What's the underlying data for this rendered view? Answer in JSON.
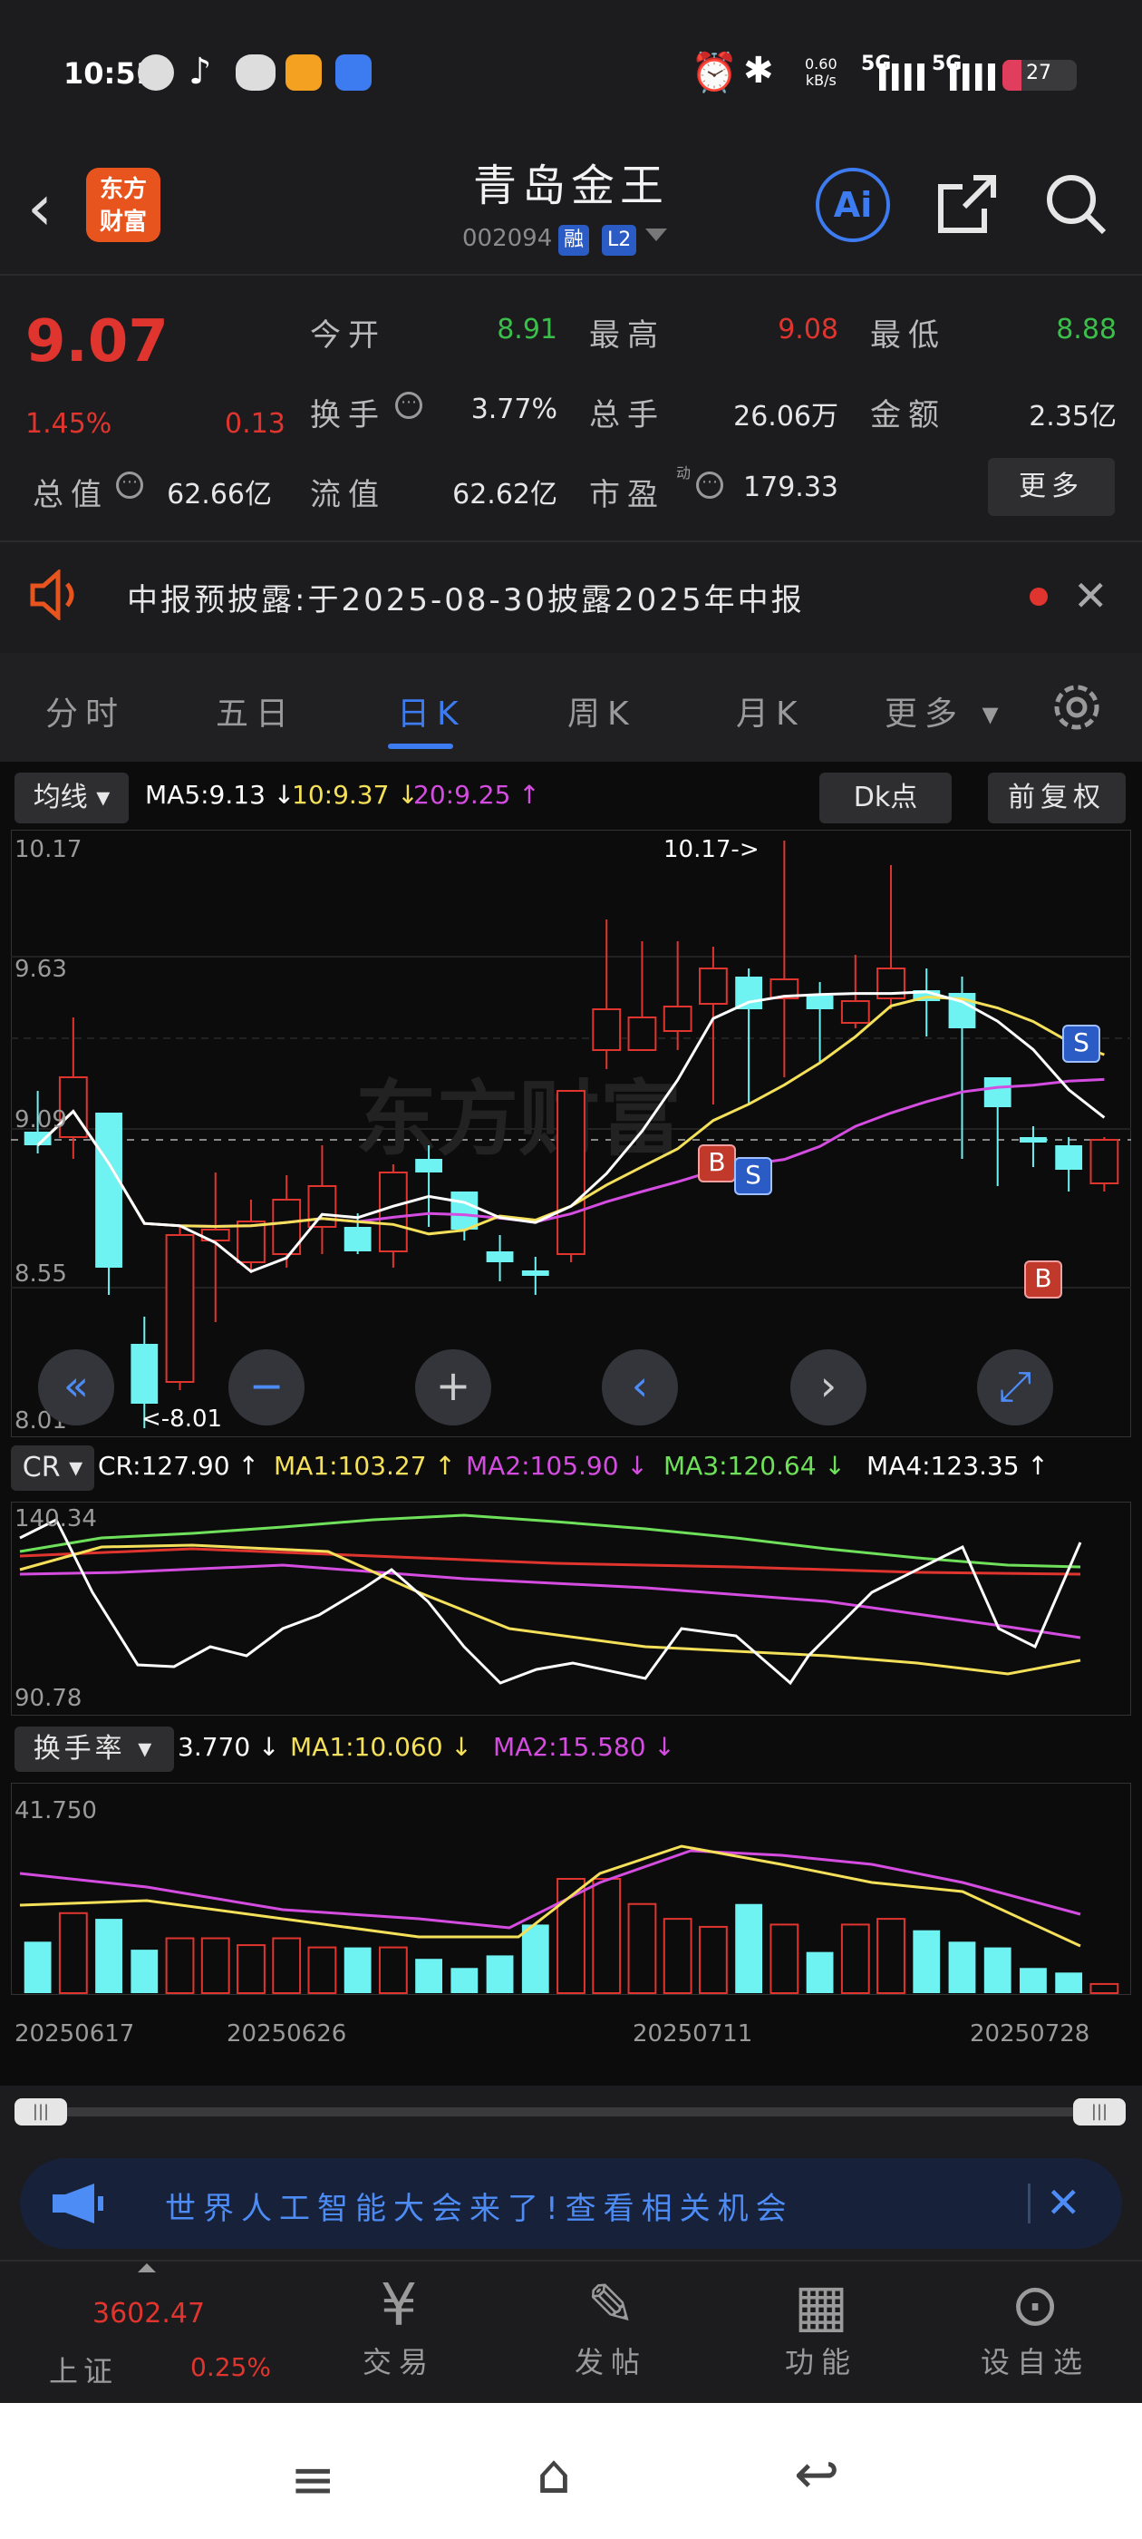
{
  "status": {
    "time": "10:51",
    "net_speed_top": "0.60",
    "net_speed_unit": "kB/s",
    "sig1": "5G",
    "sig2": "5G",
    "battery": "27"
  },
  "header": {
    "logo": "东方\n财富",
    "title": "青岛金王",
    "code": "002094",
    "badge1": "融",
    "badge2": "L2",
    "ai": "Ai"
  },
  "quote": {
    "price": "9.07",
    "change_pct": "1.45%",
    "change": "0.13",
    "open_label": "今开",
    "open": "8.91",
    "high_label": "最高",
    "high": "9.08",
    "low_label": "最低",
    "low": "8.88",
    "turnover_label": "换手",
    "turnover": "3.77%",
    "volume_label": "总手",
    "volume": "26.06万",
    "amount_label": "金额",
    "amount": "2.35亿",
    "mktcap_label": "总值",
    "mktcap": "62.66亿",
    "float_label": "流值",
    "float": "62.62亿",
    "pe_label": "市盈",
    "pe_sup": "动",
    "pe": "179.33",
    "more": "更多"
  },
  "notice": {
    "text": "中报预披露:于2025-08-30披露2025年中报"
  },
  "tabs": [
    "分时",
    "五日",
    "日K",
    "周K",
    "月K",
    "更多"
  ],
  "kline": {
    "ma_select": "均线",
    "ma5": "MA5:9.13 ↓",
    "ma10": "10:9.37 ↓",
    "ma20": "20:9.25 ↑",
    "dk": "Dk点",
    "adjust": "前复权",
    "y_labels": [
      "10.17",
      "9.63",
      "9.09",
      "8.55",
      "8.01"
    ],
    "high_note": "10.17->",
    "low_note": "<-8.01"
  },
  "cr": {
    "select": "CR",
    "cr": "CR:127.90 ↑",
    "ma1": "MA1:103.27 ↑",
    "ma2": "MA2:105.90 ↓",
    "ma3": "MA3:120.64 ↓",
    "ma4": "MA4:123.35 ↑",
    "ytop": "140.34",
    "ybot": "90.78"
  },
  "turn": {
    "select": "换手率",
    "val": "3.770 ↓",
    "ma1": "MA1:10.060 ↓",
    "ma2": "MA2:15.580 ↓",
    "ytop": "41.750"
  },
  "dates": [
    "20250617",
    "20250626",
    "20250711",
    "20250728"
  ],
  "banner": {
    "text": "世界人工智能大会来了!查看相关机会"
  },
  "bottomnav": {
    "index_value": "3602.47",
    "index_name": "上证",
    "index_pct": "0.25%",
    "trade": "交易",
    "post": "发帖",
    "func": "功能",
    "watch": "设自选"
  },
  "colors": {
    "up": "#e0352f",
    "down": "#6ef2f2",
    "ma5": "#ffffff",
    "ma10": "#f5e05a",
    "ma20": "#d44de0",
    "accent": "#3d7bf0"
  },
  "chart_data": {
    "type": "candlestick",
    "series": [
      {
        "o": 9.1,
        "c": 9.05,
        "h": 9.25,
        "l": 9.02
      },
      {
        "o": 9.08,
        "c": 9.3,
        "h": 9.52,
        "l": 9.0
      },
      {
        "o": 9.17,
        "c": 8.6,
        "h": 9.17,
        "l": 8.5
      },
      {
        "o": 8.32,
        "c": 8.1,
        "h": 8.42,
        "l": 8.01
      },
      {
        "o": 8.18,
        "c": 8.72,
        "h": 8.75,
        "l": 8.15
      },
      {
        "o": 8.7,
        "c": 8.74,
        "h": 8.95,
        "l": 8.4
      },
      {
        "o": 8.62,
        "c": 8.77,
        "h": 8.85,
        "l": 8.58
      },
      {
        "o": 8.65,
        "c": 8.85,
        "h": 8.94,
        "l": 8.6
      },
      {
        "o": 8.75,
        "c": 8.9,
        "h": 9.05,
        "l": 8.65
      },
      {
        "o": 8.75,
        "c": 8.66,
        "h": 8.8,
        "l": 8.65
      },
      {
        "o": 8.66,
        "c": 8.95,
        "h": 8.98,
        "l": 8.6
      },
      {
        "o": 9.0,
        "c": 8.95,
        "h": 9.05,
        "l": 8.75
      },
      {
        "o": 8.88,
        "c": 8.74,
        "h": 8.88,
        "l": 8.7
      },
      {
        "o": 8.66,
        "c": 8.62,
        "h": 8.72,
        "l": 8.55
      },
      {
        "o": 8.59,
        "c": 8.57,
        "h": 8.64,
        "l": 8.5
      },
      {
        "o": 8.65,
        "c": 9.25,
        "h": 9.25,
        "l": 8.62
      },
      {
        "o": 9.4,
        "c": 9.55,
        "h": 9.88,
        "l": 9.33
      },
      {
        "o": 9.4,
        "c": 9.52,
        "h": 9.8,
        "l": 9.45
      },
      {
        "o": 9.47,
        "c": 9.56,
        "h": 9.8,
        "l": 9.4
      },
      {
        "o": 9.57,
        "c": 9.7,
        "h": 9.78,
        "l": 9.2
      },
      {
        "o": 9.67,
        "c": 9.55,
        "h": 9.7,
        "l": 9.2
      },
      {
        "o": 9.59,
        "c": 9.66,
        "h": 10.17,
        "l": 9.3
      },
      {
        "o": 9.6,
        "c": 9.55,
        "h": 9.65,
        "l": 9.35
      },
      {
        "o": 9.5,
        "c": 9.58,
        "h": 9.75,
        "l": 9.48
      },
      {
        "o": 9.59,
        "c": 9.7,
        "h": 10.08,
        "l": 9.55
      },
      {
        "o": 9.62,
        "c": 9.58,
        "h": 9.7,
        "l": 9.45
      },
      {
        "o": 9.61,
        "c": 9.48,
        "h": 9.67,
        "l": 9.0
      },
      {
        "o": 9.3,
        "c": 9.19,
        "h": 9.3,
        "l": 8.9
      },
      {
        "o": 9.08,
        "c": 9.06,
        "h": 9.12,
        "l": 8.97
      },
      {
        "o": 9.05,
        "c": 8.96,
        "h": 9.08,
        "l": 8.88
      },
      {
        "o": 8.91,
        "c": 9.07,
        "h": 9.08,
        "l": 8.88
      }
    ],
    "ylim": [
      8.01,
      10.17
    ]
  }
}
